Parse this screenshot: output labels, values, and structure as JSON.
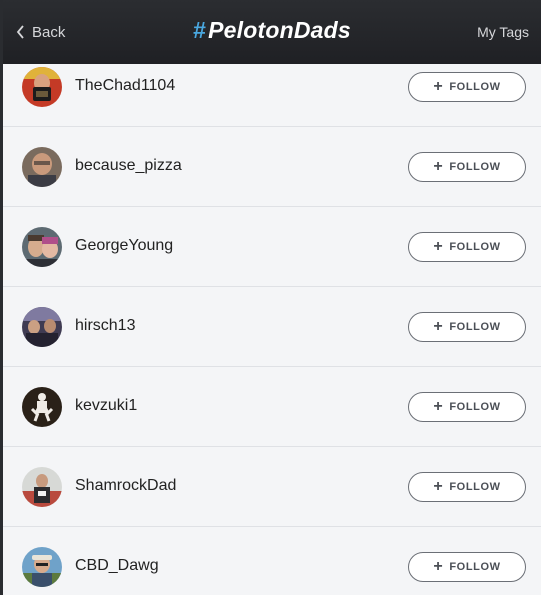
{
  "header": {
    "back_label": "Back",
    "brand_hash": "#",
    "brand_name": "PelotonDads",
    "my_tags_label": "My Tags"
  },
  "follow_label": "FOLLOW",
  "users": [
    {
      "username": "TheChad1104"
    },
    {
      "username": "because_pizza"
    },
    {
      "username": "GeorgeYoung"
    },
    {
      "username": "hirsch13"
    },
    {
      "username": "kevzuki1"
    },
    {
      "username": "ShamrockDad"
    },
    {
      "username": "CBD_Dawg"
    }
  ],
  "colors": {
    "accent": "#4aa8e0",
    "header_bg": "#2b2d31",
    "list_bg": "#f4f5f7"
  }
}
